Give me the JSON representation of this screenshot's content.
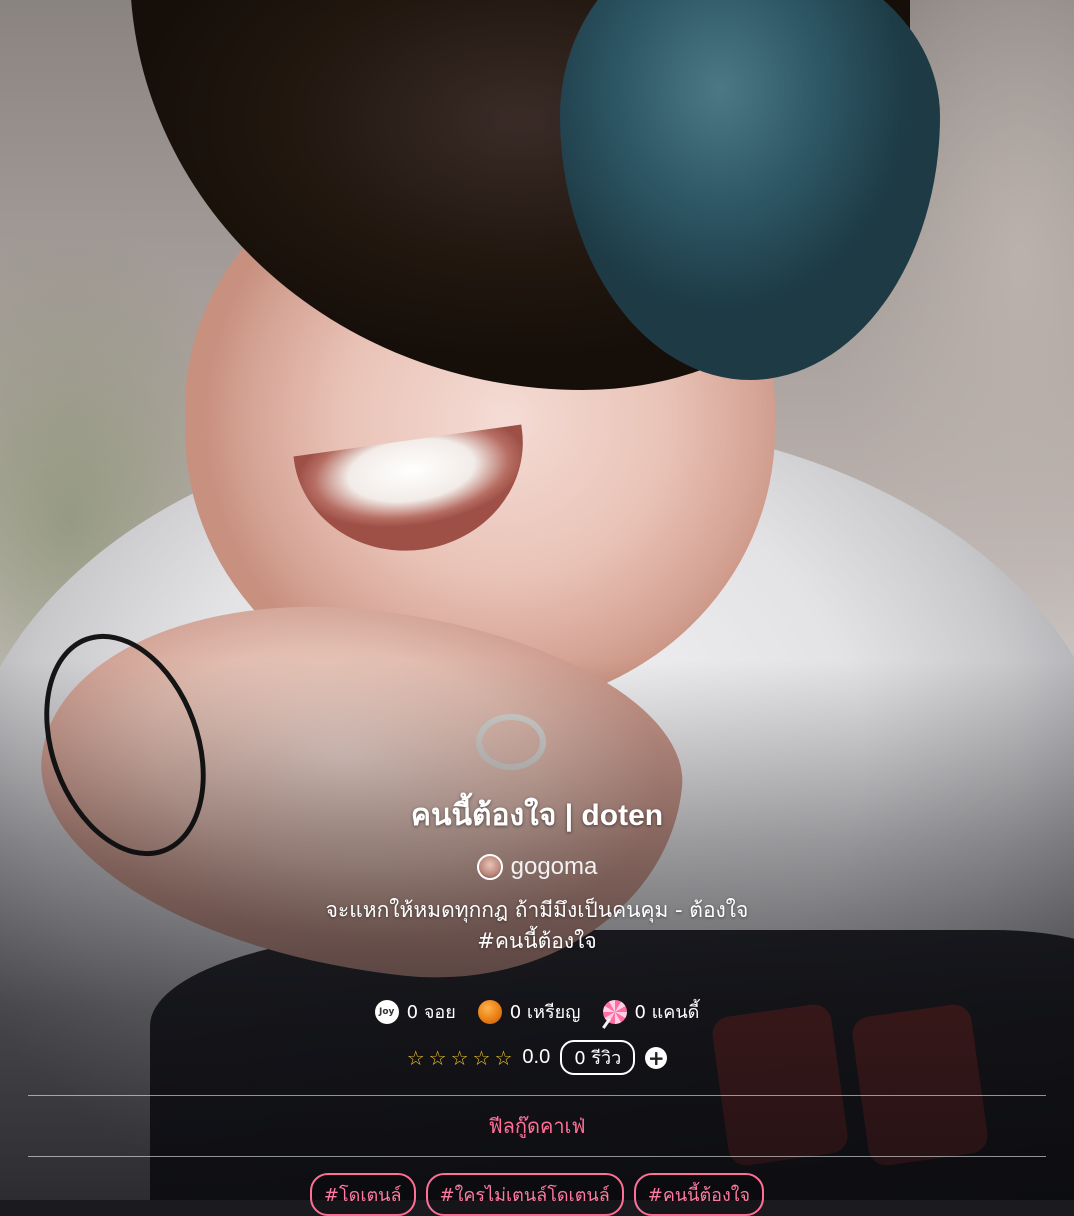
{
  "story": {
    "title": "คนนี้ต้องใจ | doten",
    "author": "gogoma",
    "description_line1": "จะแหกให้หมดทุกกฎ ถ้ามีมึงเป็นคนคุม - ต้องใจ",
    "description_line2": "#คนนี้ต้องใจ"
  },
  "stats": {
    "joy_icon_text": "Joy",
    "joy": "0 จอย",
    "coins": "0 เหรียญ",
    "candy": "0 แคนดี้"
  },
  "rating": {
    "stars": [
      "☆",
      "☆",
      "☆",
      "☆",
      "☆"
    ],
    "value": "0.0",
    "reviews": "0 รีวิว",
    "add_label": "+"
  },
  "category": "ฟีลกู๊ดคาเฟ่",
  "tags": [
    "#โดเตนล์",
    "#ใครไม่เตนล์โดเตนล์",
    "#คนนี้ต้องใจ"
  ],
  "colors": {
    "accent": "#ff6f96",
    "star": "#f0c020",
    "coin": "#e67b12"
  },
  "icons": [
    "joy-icon",
    "coin-icon",
    "candy-icon",
    "star-icon",
    "plus-icon"
  ]
}
